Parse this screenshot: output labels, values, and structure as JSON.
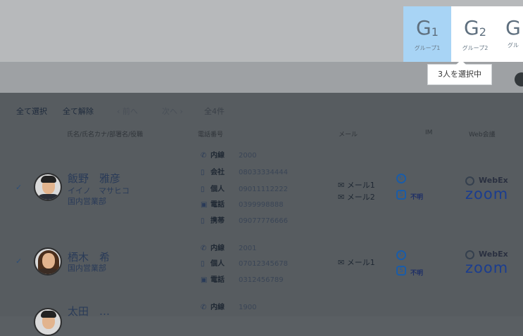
{
  "groups": [
    {
      "label": "G",
      "num": "1",
      "sub": "グループ1",
      "active": true
    },
    {
      "label": "G",
      "num": "2",
      "sub": "グループ2",
      "active": false
    },
    {
      "label": "G",
      "num": "",
      "sub": "グル",
      "active": false
    }
  ],
  "tooltip": "3人を選択中",
  "toolbar": {
    "select_all": "全て選択",
    "deselect_all": "全て解除",
    "prev": "前へ",
    "next": "次へ",
    "count": "全4件"
  },
  "headers": {
    "name": "氏名/氏名カナ/部署名/役職",
    "phone": "電話番号",
    "mail": "メール",
    "im": "IM",
    "web": "Web会議"
  },
  "people": [
    {
      "name": "飯野　雅彦",
      "kana": "イイノ　マサヒコ",
      "dept": "国内営業部",
      "phones": [
        {
          "icon": "phone-icon",
          "label": "内線",
          "number": "2000"
        },
        {
          "icon": "mobile-icon",
          "label": "会社",
          "number": "08033334444"
        },
        {
          "icon": "mobile-icon",
          "label": "個人",
          "number": "09011112222"
        },
        {
          "icon": "fax-icon",
          "label": "電話",
          "number": "0399998888"
        },
        {
          "icon": "mobile-icon",
          "label": "携帯",
          "number": "09077776666"
        }
      ],
      "mails": [
        "メール1",
        "メール2"
      ],
      "im_status": "不明",
      "web": [
        "WebEx",
        "zoom"
      ]
    },
    {
      "name": "栖木　希",
      "kana": "",
      "dept": "国内営業部",
      "phones": [
        {
          "icon": "phone-icon",
          "label": "内線",
          "number": "2001"
        },
        {
          "icon": "mobile-icon",
          "label": "個人",
          "number": "07012345678"
        },
        {
          "icon": "fax-icon",
          "label": "電話",
          "number": "0312456789"
        }
      ],
      "mails": [
        "メール1"
      ],
      "im_status": "不明",
      "web": [
        "WebEx",
        "zoom"
      ]
    },
    {
      "name": "太田　…",
      "phones": [
        {
          "icon": "phone-icon",
          "label": "内線",
          "number": "1900"
        }
      ]
    }
  ]
}
